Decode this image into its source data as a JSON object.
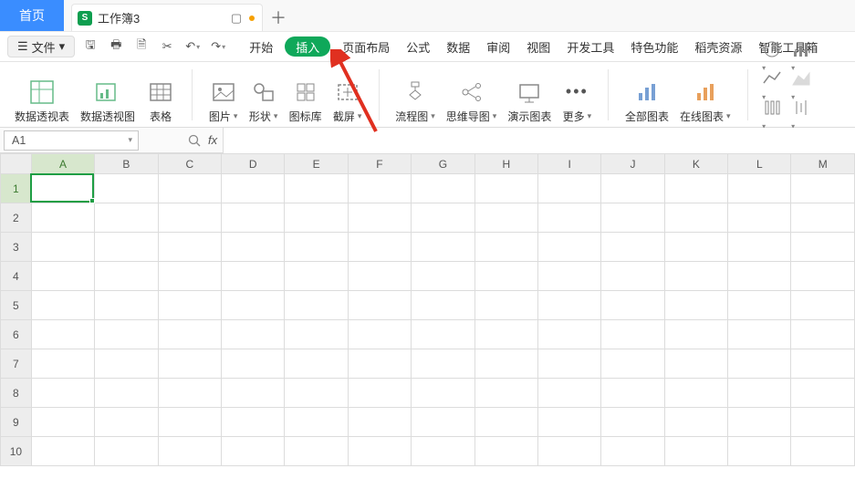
{
  "tabstrip": {
    "home_label": "首页",
    "doc_title": "工作簿3",
    "app_icon_label": "S",
    "maximize_glyph": "▢",
    "add_tab_glyph": "＋"
  },
  "filerow": {
    "menu_glyph": "☰",
    "file_label": "文件",
    "dropdown_glyph": "▾",
    "quick_icons": {
      "save": "🖫",
      "print": "🖶",
      "preview": "🗎",
      "cut": "✂",
      "undo": "↶",
      "redo": "↷"
    }
  },
  "menu": {
    "items": [
      "开始",
      "插入",
      "页面布局",
      "公式",
      "数据",
      "审阅",
      "视图",
      "开发工具",
      "特色功能",
      "稻壳资源",
      "智能工具箱"
    ],
    "active_index": 1
  },
  "ribbon": {
    "group1": {
      "pivot_table": "数据透视表",
      "pivot_chart": "数据透视图",
      "table": "表格"
    },
    "group2": {
      "picture": "图片",
      "shapes": "形状",
      "icon_lib": "图标库",
      "screenshot": "截屏"
    },
    "group3": {
      "flowchart": "流程图",
      "mindmap": "思维导图",
      "slideshow": "演示图表",
      "more": "更多"
    },
    "group4": {
      "all_charts": "全部图表",
      "online_chart": "在线图表"
    }
  },
  "formula": {
    "cell_ref": "A1",
    "fx_symbol": "fx"
  },
  "grid": {
    "columns": [
      "A",
      "B",
      "C",
      "D",
      "E",
      "F",
      "G",
      "H",
      "I",
      "J",
      "K",
      "L",
      "M"
    ],
    "rows": [
      "1",
      "2",
      "3",
      "4",
      "5",
      "6",
      "7",
      "8",
      "9",
      "10"
    ],
    "selected_col_index": 0,
    "selected_row_index": 0
  }
}
